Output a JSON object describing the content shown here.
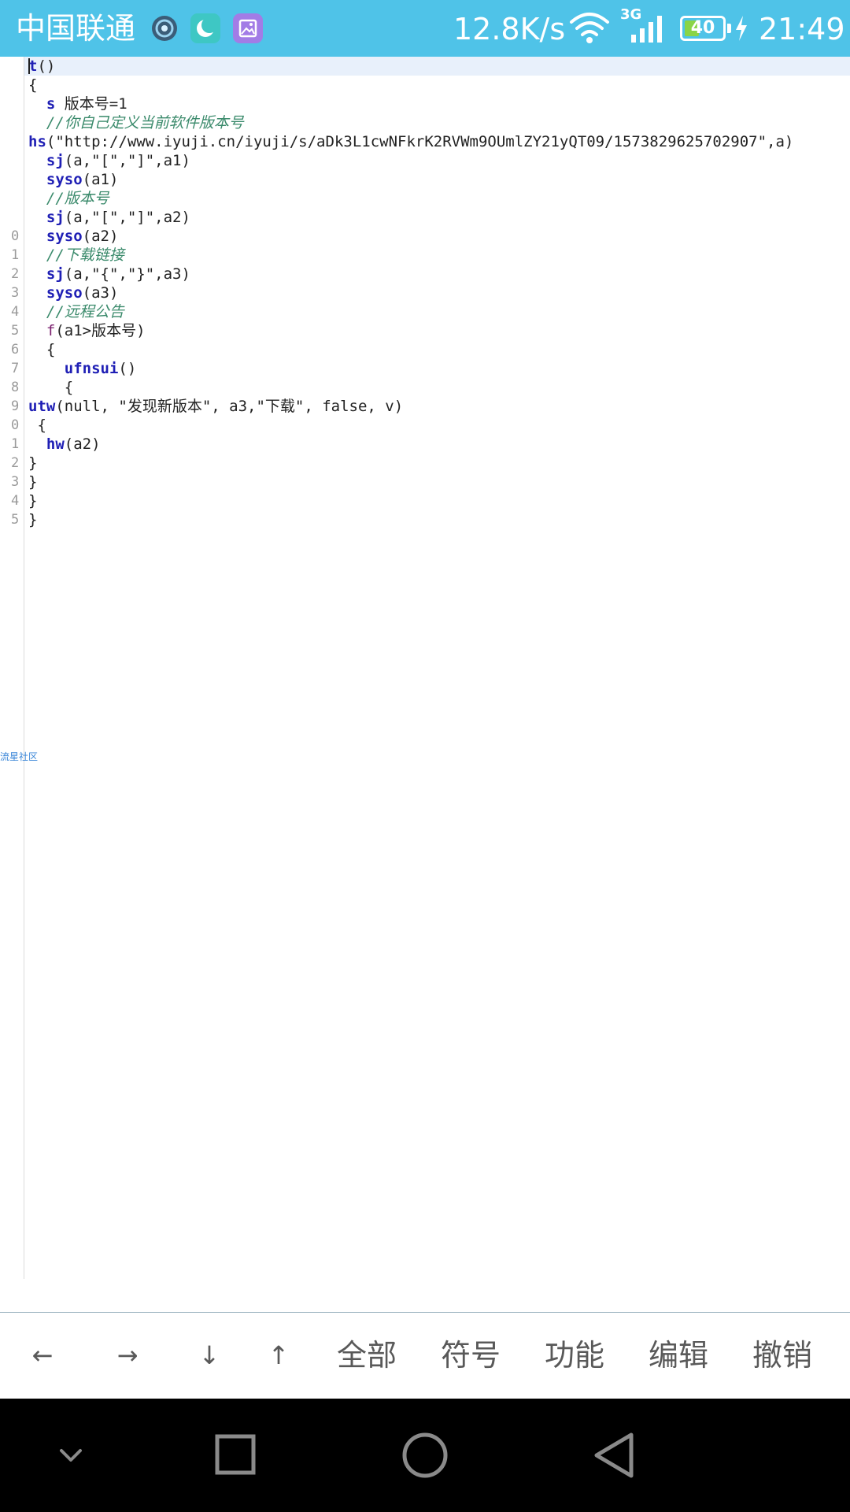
{
  "status_bar": {
    "carrier": "中国联通",
    "speed": "12.8K/s",
    "network_type": "3G",
    "battery_level": "40",
    "battery_fraction": 0.4,
    "time": "21:49",
    "app_icons": [
      "lens-app-icon",
      "moon-app-icon",
      "gallery-app-icon"
    ]
  },
  "editor": {
    "line_numbers": [
      "",
      "",
      "",
      "",
      "",
      "",
      "",
      "",
      "",
      "0",
      "1",
      "2",
      "3",
      "4",
      "5",
      "6",
      "7",
      "8",
      "9",
      "0",
      "1",
      "2",
      "3",
      "4",
      "5"
    ],
    "code_lines": [
      [
        {
          "t": "t",
          "c": "kw"
        },
        {
          "t": "()",
          "c": ""
        }
      ],
      [
        {
          "t": "{",
          "c": ""
        }
      ],
      [
        {
          "t": "  ",
          "c": ""
        },
        {
          "t": "s",
          "c": "kw"
        },
        {
          "t": " 版本号=1",
          "c": ""
        }
      ],
      [
        {
          "t": "  //你自己定义当前软件版本号",
          "c": "cm"
        }
      ],
      [
        {
          "t": "hs",
          "c": "kw"
        },
        {
          "t": "(\"http://www.iyuji.cn/iyuji/s/aDk3L1cwNFkrK2RVWm9OUmlZY21yQT09/1573829625702907\",a)",
          "c": ""
        }
      ],
      [
        {
          "t": "  ",
          "c": ""
        },
        {
          "t": "sj",
          "c": "kw"
        },
        {
          "t": "(a,\"[\",\"]\",a1)",
          "c": ""
        }
      ],
      [
        {
          "t": "  ",
          "c": ""
        },
        {
          "t": "syso",
          "c": "kw"
        },
        {
          "t": "(a1)",
          "c": ""
        }
      ],
      [
        {
          "t": "  //版本号",
          "c": "cm"
        }
      ],
      [
        {
          "t": "  ",
          "c": ""
        },
        {
          "t": "sj",
          "c": "kw"
        },
        {
          "t": "(a,\"[\",\"]\",a2)",
          "c": ""
        }
      ],
      [
        {
          "t": "  ",
          "c": ""
        },
        {
          "t": "syso",
          "c": "kw"
        },
        {
          "t": "(a2)",
          "c": ""
        }
      ],
      [
        {
          "t": "  //下载链接",
          "c": "cm"
        }
      ],
      [
        {
          "t": "  ",
          "c": ""
        },
        {
          "t": "sj",
          "c": "kw"
        },
        {
          "t": "(a,\"{\",\"}\",a3)",
          "c": ""
        }
      ],
      [
        {
          "t": "  ",
          "c": ""
        },
        {
          "t": "syso",
          "c": "kw"
        },
        {
          "t": "(a3)",
          "c": ""
        }
      ],
      [
        {
          "t": "  //远程公告",
          "c": "cm"
        }
      ],
      [
        {
          "t": "  ",
          "c": ""
        },
        {
          "t": "f",
          "c": "kw2"
        },
        {
          "t": "(a1>版本号)",
          "c": ""
        }
      ],
      [
        {
          "t": "  {",
          "c": ""
        }
      ],
      [
        {
          "t": "    ",
          "c": ""
        },
        {
          "t": "ufnsui",
          "c": "kw"
        },
        {
          "t": "()",
          "c": ""
        }
      ],
      [
        {
          "t": "    {",
          "c": ""
        }
      ],
      [
        {
          "t": "utw",
          "c": "kw"
        },
        {
          "t": "(null, \"发现新版本\", a3,\"下载\", false, v)",
          "c": ""
        }
      ],
      [
        {
          "t": " {",
          "c": ""
        }
      ],
      [
        {
          "t": "  ",
          "c": ""
        },
        {
          "t": "hw",
          "c": "kw"
        },
        {
          "t": "(a2)",
          "c": ""
        }
      ],
      [
        {
          "t": "}",
          "c": ""
        }
      ],
      [
        {
          "t": "}",
          "c": ""
        }
      ],
      [
        {
          "t": "}",
          "c": ""
        }
      ],
      [
        {
          "t": "}",
          "c": ""
        }
      ]
    ],
    "watermark": "流星社区"
  },
  "toolbar": {
    "arrows": [
      {
        "label": "←",
        "name": "left-arrow-button"
      },
      {
        "label": "→",
        "name": "right-arrow-button"
      },
      {
        "label": "↓",
        "name": "down-arrow-button"
      },
      {
        "label": "↑",
        "name": "up-arrow-button"
      }
    ],
    "buttons": [
      {
        "label": "全部",
        "name": "select-all-button"
      },
      {
        "label": "符号",
        "name": "symbols-button"
      },
      {
        "label": "功能",
        "name": "functions-button"
      },
      {
        "label": "编辑",
        "name": "edit-button"
      },
      {
        "label": "撤销",
        "name": "undo-button"
      }
    ]
  },
  "navigation": {
    "buttons": [
      "hide-keyboard-icon",
      "recents-icon",
      "home-icon",
      "back-icon"
    ]
  }
}
